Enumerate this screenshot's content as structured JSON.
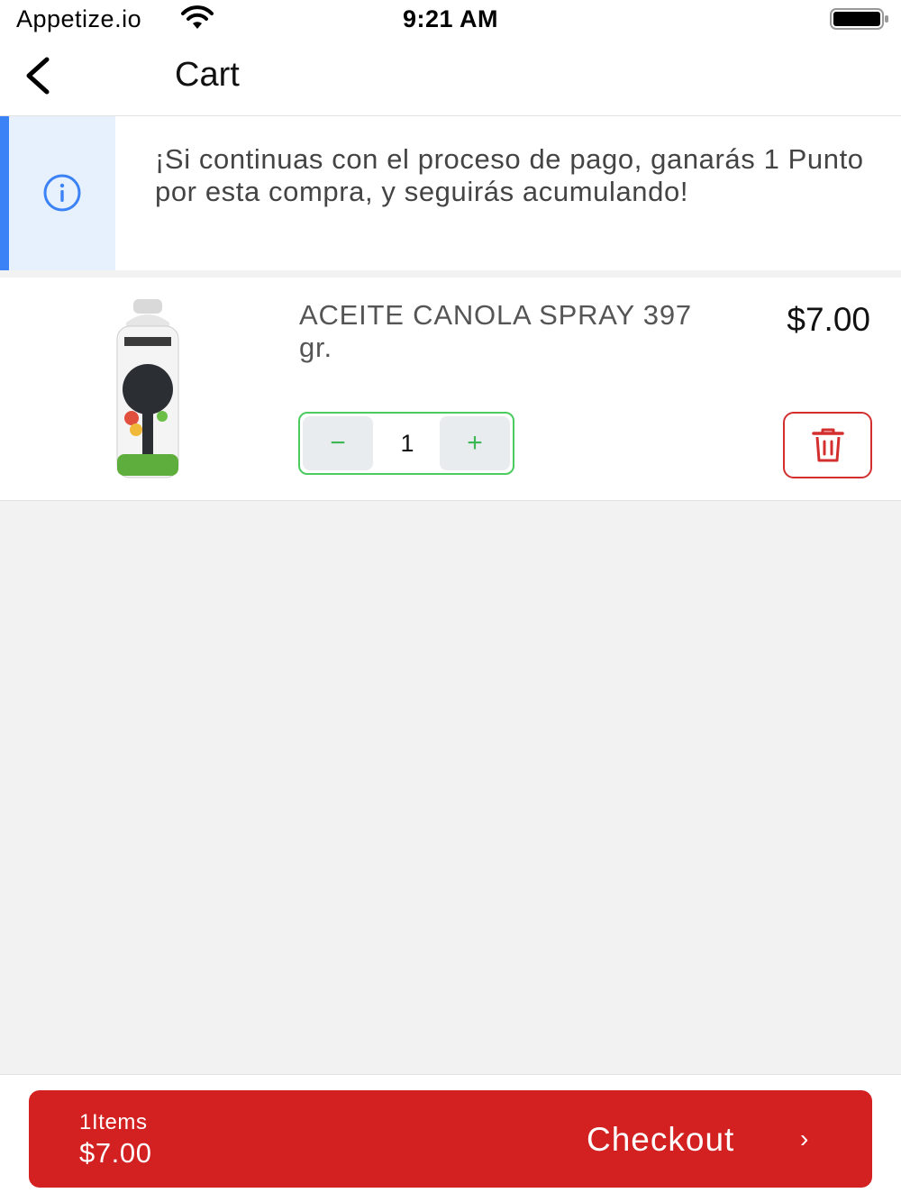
{
  "status_bar": {
    "carrier": "Appetize.io",
    "time": "9:21 AM",
    "wifi_icon": "wifi-icon",
    "battery_icon": "battery-full-icon"
  },
  "header": {
    "title": "Cart",
    "back_icon": "chevron-left-icon"
  },
  "info_banner": {
    "icon": "info-circle-icon",
    "text": "¡Si continuas con el proceso de pago, ganarás 1 Punto por esta compra, y seguirás acumulando!",
    "accent_color": "#3b82f6",
    "background_color": "#e7f0fd"
  },
  "cart_items": [
    {
      "name": "ACEITE CANOLA SPRAY 397 gr.",
      "price": "$7.00",
      "quantity": "1",
      "decrement_label": "−",
      "increment_label": "+",
      "image_icon": "canola-spray-bottle-image",
      "delete_icon": "trash-icon"
    }
  ],
  "checkout": {
    "items_count": "1Items",
    "total": "$7.00",
    "label": "Checkout",
    "arrow": "›",
    "color": "#d32121"
  },
  "colors": {
    "stepper_border": "#4ccb5f",
    "delete_border": "#d32f2f",
    "page_background": "#f2f2f2"
  }
}
